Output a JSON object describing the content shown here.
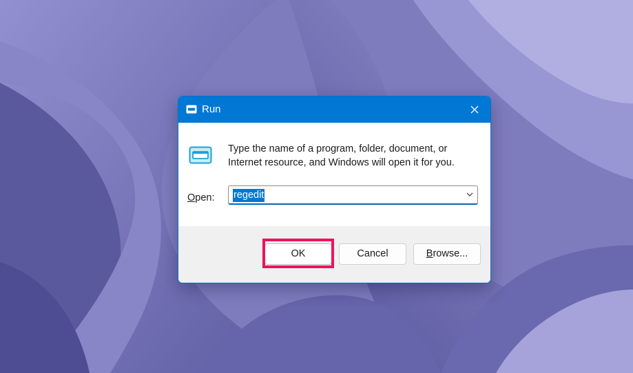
{
  "window": {
    "title": "Run",
    "close_label": "Close"
  },
  "dialog": {
    "description": "Type the name of a program, folder, document, or Internet resource, and Windows will open it for you.",
    "open_label_mnemonic": "O",
    "open_label_rest": "pen:",
    "open_value": "regedit"
  },
  "buttons": {
    "ok": "OK",
    "cancel": "Cancel",
    "browse_mnemonic": "B",
    "browse_rest": "rowse..."
  },
  "colors": {
    "title_bar": "#0078d4",
    "highlight": "#f0115f",
    "wallpaper": "#7d7bbb"
  },
  "icons": {
    "app": "run-app-icon",
    "close": "close-icon",
    "dropdown": "chevron-down-icon"
  }
}
